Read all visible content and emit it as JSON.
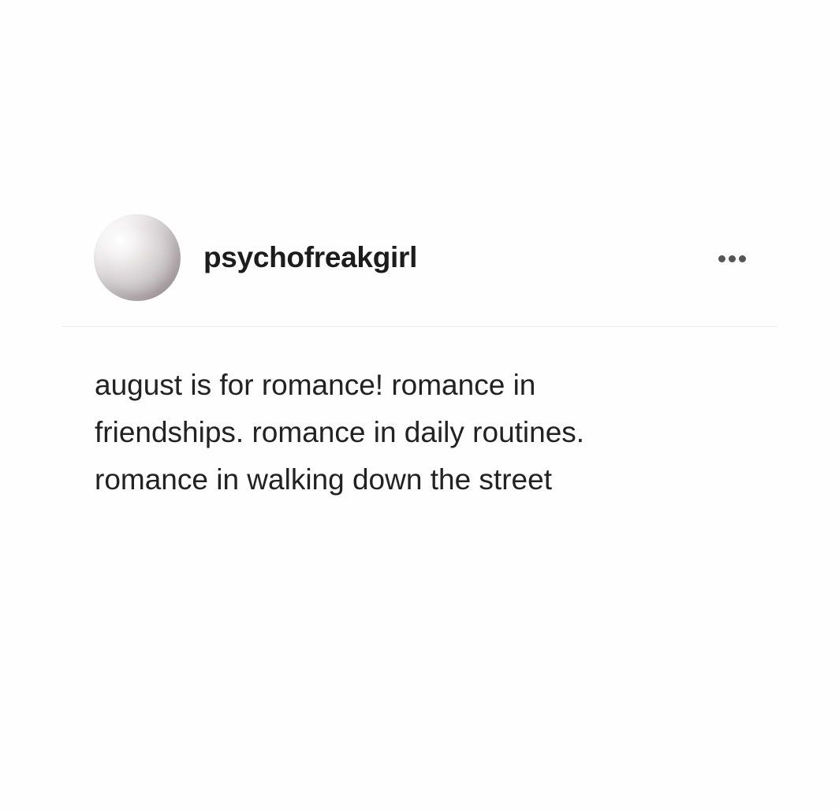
{
  "post": {
    "author": {
      "username": "psychofreakgirl",
      "avatar_icon": "pearl-avatar"
    },
    "menu_icon": "more-horizontal-icon",
    "text": "august is for romance! romance in friendships. romance in daily routines. romance in walking down the street"
  }
}
